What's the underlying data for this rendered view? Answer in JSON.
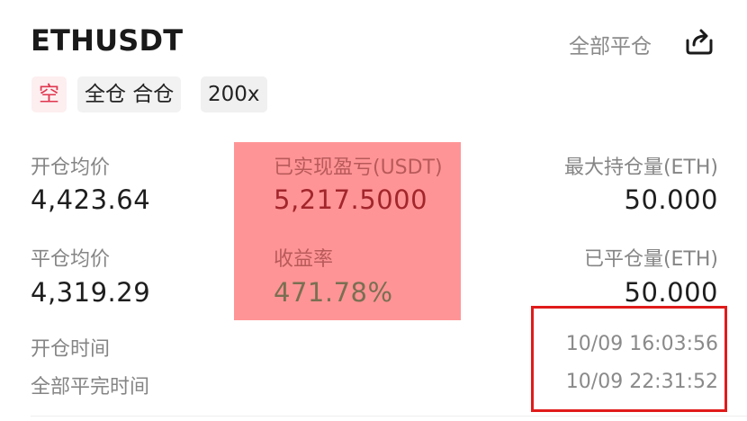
{
  "position": {
    "symbol": "ETHUSDT",
    "close_all_label": "全部平仓",
    "tags": {
      "side": "空",
      "margin_mode": "全仓 合仓",
      "leverage": "200x"
    }
  },
  "stats": {
    "avg_open_price_label": "开仓均价",
    "avg_open_price": "4,423.64",
    "avg_close_price_label": "平仓均价",
    "avg_close_price": "4,319.29",
    "realized_pnl_label": "已实现盈亏(USDT)",
    "realized_pnl": "5,217.5000",
    "roe_label": "收益率",
    "roe": "471.78%",
    "max_position_label": "最大持仓量(ETH)",
    "max_position": "50.000",
    "closed_qty_label": "已平仓量(ETH)",
    "closed_qty": "50.000"
  },
  "times": {
    "open_time_label": "开仓时间",
    "open_time": "10/09 16:03:56",
    "full_close_time_label": "全部平完时间",
    "full_close_time": "10/09 22:31:52"
  },
  "icons": {
    "share": "share-icon"
  },
  "colors": {
    "short_tag_text": "#e0364e",
    "short_tag_bg": "#fdeef0",
    "highlight_overlay": "#ff9496",
    "annotation_box": "#e11b1b",
    "pnl_value": "#a2262c"
  }
}
